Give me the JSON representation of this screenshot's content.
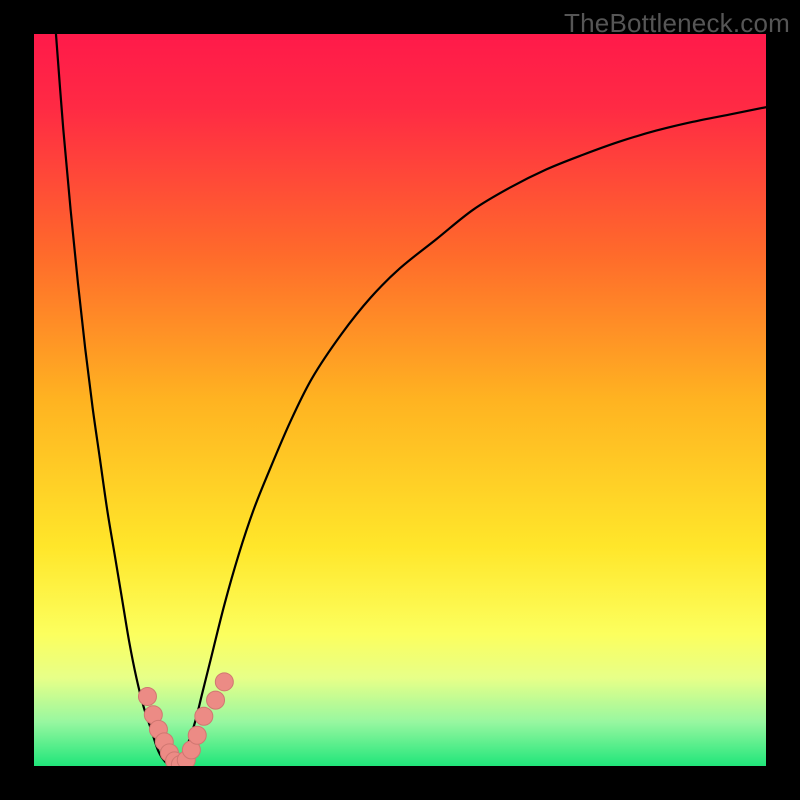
{
  "watermark": "TheBottleneck.com",
  "colors": {
    "gradient_stops": [
      {
        "offset": 0.0,
        "color": "#ff1a4a"
      },
      {
        "offset": 0.1,
        "color": "#ff2a44"
      },
      {
        "offset": 0.3,
        "color": "#ff6a2b"
      },
      {
        "offset": 0.5,
        "color": "#ffb321"
      },
      {
        "offset": 0.7,
        "color": "#ffe62a"
      },
      {
        "offset": 0.82,
        "color": "#fcff5e"
      },
      {
        "offset": 0.88,
        "color": "#e7ff88"
      },
      {
        "offset": 0.94,
        "color": "#97f7a0"
      },
      {
        "offset": 1.0,
        "color": "#20e67a"
      }
    ],
    "curve": "#000000",
    "marker_fill": "#ec8b85",
    "marker_stroke": "#d07771"
  },
  "chart_data": {
    "type": "line",
    "title": "",
    "xlabel": "",
    "ylabel": "",
    "xlim": [
      0,
      100
    ],
    "ylim": [
      0,
      100
    ],
    "series": [
      {
        "name": "bottleneck-curve",
        "x": [
          3,
          4,
          5,
          6,
          7,
          8,
          9,
          10,
          11,
          12,
          13,
          14,
          15,
          16,
          17,
          18,
          19,
          20,
          21,
          22,
          23,
          24,
          26,
          28,
          30,
          32,
          35,
          38,
          42,
          46,
          50,
          55,
          60,
          65,
          70,
          75,
          80,
          85,
          90,
          95,
          100
        ],
        "y": [
          100,
          87,
          76,
          66,
          57,
          49,
          42,
          35,
          29,
          23,
          17,
          12,
          8,
          5,
          2,
          0.5,
          0,
          1,
          3,
          6,
          10,
          14,
          22,
          29,
          35,
          40,
          47,
          53,
          59,
          64,
          68,
          72,
          76,
          79,
          81.5,
          83.5,
          85.3,
          86.8,
          88,
          89,
          90
        ]
      }
    ],
    "markers": {
      "name": "highlighted-points",
      "x": [
        15.5,
        16.3,
        17.0,
        17.8,
        18.5,
        19.2,
        20.0,
        20.8,
        21.5,
        22.3,
        23.2,
        24.8,
        26.0
      ],
      "y": [
        9.5,
        7.0,
        5.0,
        3.3,
        1.8,
        0.7,
        0.2,
        0.8,
        2.2,
        4.2,
        6.8,
        9.0,
        11.5
      ]
    }
  }
}
